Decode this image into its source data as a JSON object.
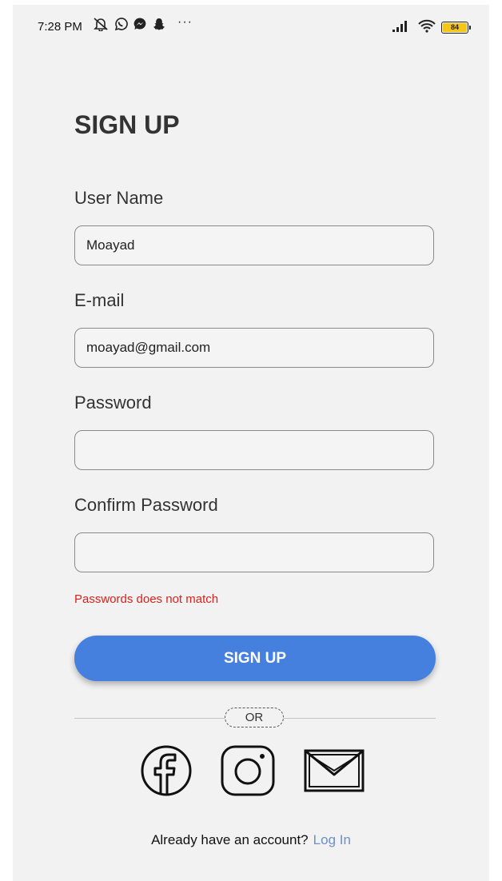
{
  "status_bar": {
    "time": "7:28 PM",
    "battery_level": "84",
    "icons": [
      "mute-icon",
      "whatsapp-icon",
      "messenger-icon",
      "snapchat-icon"
    ],
    "more": "···"
  },
  "form": {
    "title": "SIGN UP",
    "username": {
      "label": "User Name",
      "value": "Moayad"
    },
    "email": {
      "label": "E-mail",
      "value": "moayad@gmail.com"
    },
    "password": {
      "label": "Password",
      "value": ""
    },
    "confirm_password": {
      "label": "Confirm Password",
      "value": ""
    },
    "error": "Passwords does not match",
    "submit_label": "SIGN UP"
  },
  "divider": {
    "label": "OR"
  },
  "social": [
    "facebook-icon",
    "instagram-icon",
    "mail-icon"
  ],
  "footer": {
    "prompt": "Already have an account?",
    "link": "Log In"
  },
  "colors": {
    "accent": "#4580df",
    "error": "#d8221c",
    "link": "#6f8fc6",
    "background": "#f2f2f2",
    "battery": "#f5c518"
  }
}
